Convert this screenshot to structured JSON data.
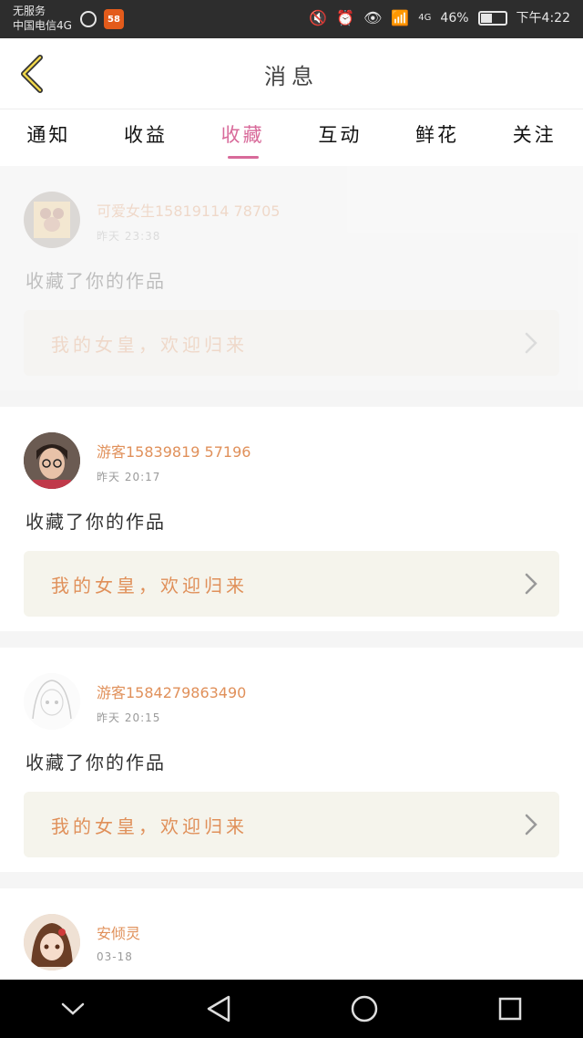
{
  "status_bar": {
    "line1": "无服务",
    "line2": "中国电信4G",
    "network": "4G",
    "battery_percent": "46%",
    "battery_level": 0.46,
    "time": "下午4:22"
  },
  "header": {
    "title": "消息"
  },
  "tabs": [
    {
      "label": "通知",
      "active": false
    },
    {
      "label": "收益",
      "active": false
    },
    {
      "label": "收藏",
      "active": true
    },
    {
      "label": "互动",
      "active": false
    },
    {
      "label": "鲜花",
      "active": false
    },
    {
      "label": "关注",
      "active": false
    }
  ],
  "feed": [
    {
      "username": "可爱女生15819114 78705",
      "time": "昨天 23:38",
      "action": "收藏了你的作品",
      "work_title": "我的女皇，欢迎归来",
      "faded": true
    },
    {
      "username": "游客15839819 57196",
      "time": "昨天 20:17",
      "action": "收藏了你的作品",
      "work_title": "我的女皇，欢迎归来",
      "faded": false
    },
    {
      "username": "游客1584279863490",
      "time": "昨天 20:15",
      "action": "收藏了你的作品",
      "work_title": "我的女皇，欢迎归来",
      "faded": false
    },
    {
      "username": "安倾灵",
      "time": "03-18",
      "action": "",
      "work_title": "",
      "faded": false
    }
  ],
  "colors": {
    "accent": "#d86a9a",
    "username": "#e0905a",
    "card_link_bg": "#f5f4ec"
  }
}
